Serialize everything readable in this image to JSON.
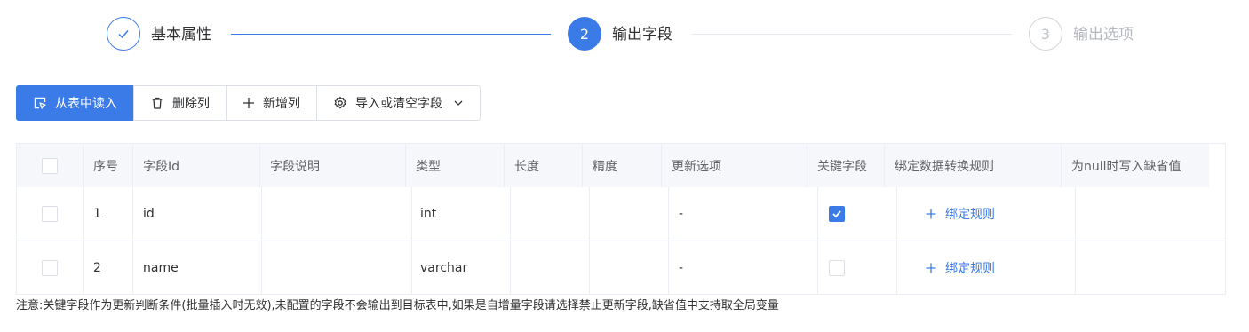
{
  "steps": [
    {
      "label": "基本属性",
      "number": "1",
      "status": "done"
    },
    {
      "label": "输出字段",
      "number": "2",
      "status": "active"
    },
    {
      "label": "输出选项",
      "number": "3",
      "status": "wait"
    }
  ],
  "toolbar": {
    "read_from_table": "从表中读入",
    "delete_column": "删除列",
    "add_column": "新增列",
    "import_or_clear": "导入或清空字段"
  },
  "table": {
    "headers": {
      "index": "序号",
      "field_id": "字段Id",
      "field_desc": "字段说明",
      "type": "类型",
      "length": "长度",
      "precision": "精度",
      "update_option": "更新选项",
      "key_field": "关键字段",
      "bind_rule": "绑定数据转换规则",
      "default_value": "为null时写入缺省值"
    },
    "rows": [
      {
        "index": "1",
        "field_id": "id",
        "field_desc": "",
        "type": "int",
        "length": "",
        "precision": "",
        "update_option": "-",
        "key_field": true,
        "bind_rule": "绑定规则",
        "default_value": ""
      },
      {
        "index": "2",
        "field_id": "name",
        "field_desc": "",
        "type": "varchar",
        "length": "",
        "precision": "",
        "update_option": "-",
        "key_field": false,
        "bind_rule": "绑定规则",
        "default_value": ""
      }
    ]
  },
  "note": "注意:关键字段作为更新判断条件(批量插入时无效),未配置的字段不会输出到目标表中,如果是自增量字段请选择禁止更新字段,缺省值中支持取全局变量",
  "colors": {
    "primary": "#3b7be8",
    "border": "#ebeef5",
    "header_bg": "#f5f7fa",
    "muted": "#c0c4cc"
  }
}
